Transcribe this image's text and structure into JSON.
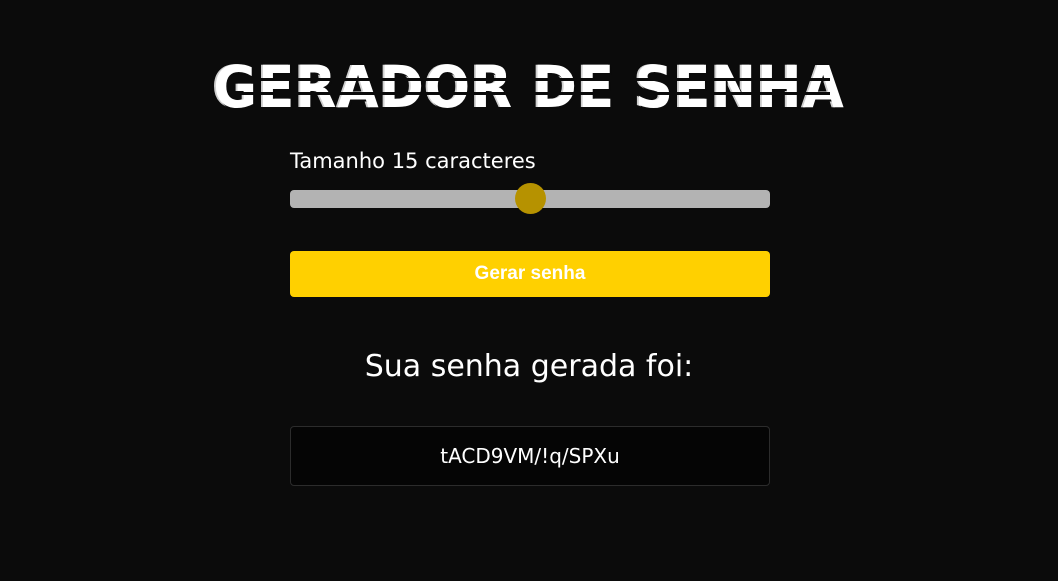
{
  "header": {
    "title": "GERADOR DE SENHA"
  },
  "length": {
    "label": "Tamanho 15 caracteres",
    "value": 15,
    "slider_fraction": 0.5
  },
  "actions": {
    "generate_label": "Gerar senha"
  },
  "result": {
    "label": "Sua senha gerada foi:",
    "password": "tACD9VM/!q/SPXu"
  },
  "colors": {
    "background": "#0b0b0b",
    "accent": "#ffd000",
    "slider_track": "#b3b3b3",
    "slider_thumb": "#b69200",
    "password_box": "#050505"
  }
}
